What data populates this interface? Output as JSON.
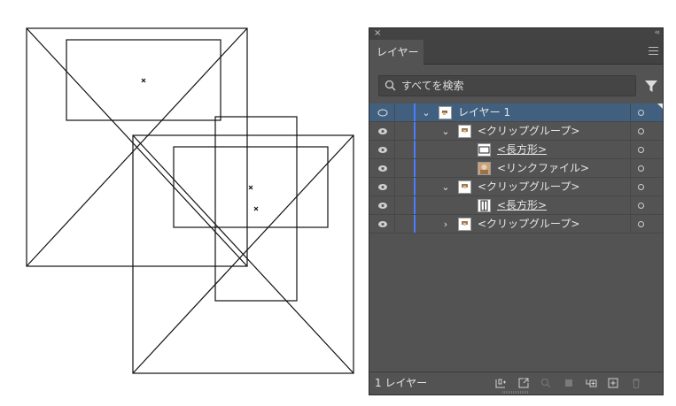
{
  "panel": {
    "close_glyph": "×",
    "collapse_glyph": "‹‹",
    "tab_label": "レイヤー",
    "search_placeholder": "すべてを検索",
    "footer_count": "1 レイヤー",
    "accent_color": "#4a7dff",
    "selected_row_color": "#41607f"
  },
  "layers": [
    {
      "label": "レイヤー 1",
      "chevron": "⌄",
      "underline": false,
      "selected": true,
      "thumb": "layer-thumb"
    },
    {
      "label": "<クリップグループ>",
      "chevron": "⌄",
      "underline": false,
      "selected": false,
      "thumb": "group-thumb"
    },
    {
      "label": "<長方形>",
      "chevron": "",
      "underline": true,
      "selected": false,
      "thumb": "rect-wide-thumb"
    },
    {
      "label": "<リンクファイル>",
      "chevron": "",
      "underline": false,
      "selected": false,
      "thumb": "image-thumb"
    },
    {
      "label": "<クリップグループ>",
      "chevron": "⌄",
      "underline": false,
      "selected": false,
      "thumb": "group-thumb"
    },
    {
      "label": "<長方形>",
      "chevron": "",
      "underline": true,
      "selected": false,
      "thumb": "rect-tall-thumb"
    },
    {
      "label": "<クリップグループ>",
      "chevron": "›",
      "underline": false,
      "selected": false,
      "thumb": "group-thumb"
    }
  ],
  "footer_icons": [
    "collect-export-icon",
    "export-icon",
    "locate-object-icon",
    "clipping-mask-icon",
    "new-sublayer-icon",
    "new-layer-icon",
    "delete-icon"
  ]
}
